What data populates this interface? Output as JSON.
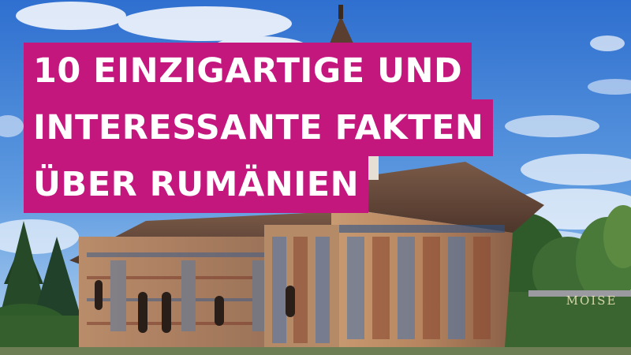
{
  "headline": {
    "lines": [
      "10 EINZIGARTIGE UND",
      "INTERESSANTE FAKTEN",
      "ÜBER RUMÄNIEN"
    ]
  },
  "watermark": "MOISE",
  "colors": {
    "banner": "#c4177e",
    "banner_text": "#ffffff",
    "sky_top": "#2f6fcf",
    "sky_bottom": "#a9cdf0",
    "roof": "#6b4a3a"
  }
}
